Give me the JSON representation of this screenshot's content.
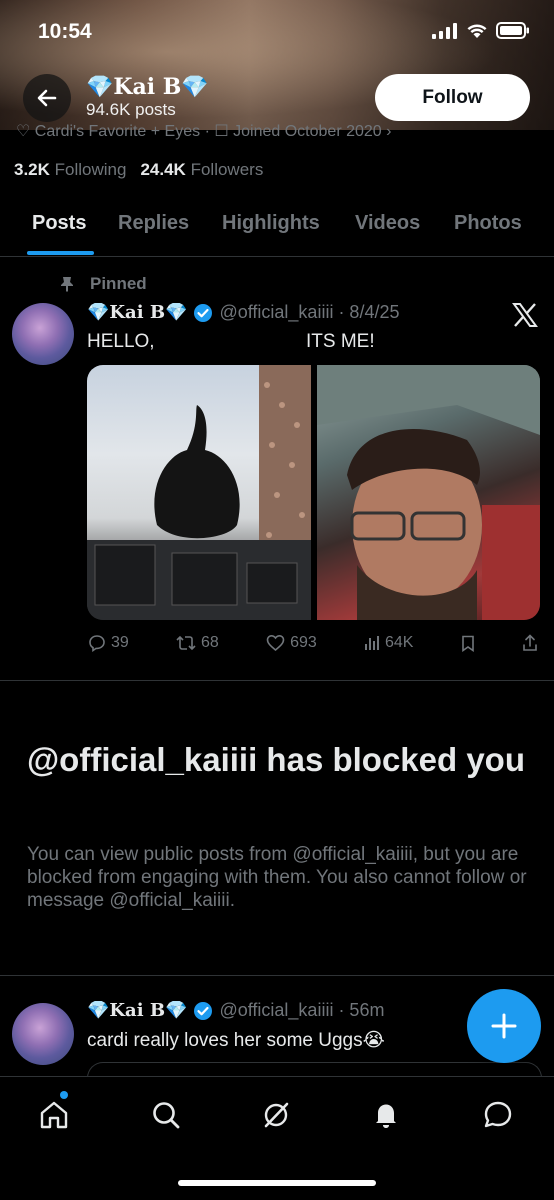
{
  "status_bar": {
    "time": "10:54"
  },
  "header": {
    "name": "💎Kai B💎",
    "posts_count": "94.6K posts",
    "follow_label": "Follow",
    "cutoff_text": "♡ Cardi's Favorite + Eyes · ☐ Joined October 2020 ›"
  },
  "profile": {
    "following_count": "3.2K",
    "following_label": "Following",
    "followers_count": "24.4K",
    "followers_label": "Followers"
  },
  "tabs": [
    {
      "label": "Posts",
      "active": true
    },
    {
      "label": "Replies"
    },
    {
      "label": "Highlights"
    },
    {
      "label": "Videos"
    },
    {
      "label": "Photos"
    }
  ],
  "pinned_post": {
    "pinned_label": "Pinned",
    "author_name": "💎Kai B💎",
    "handle_date": "@official_kaiiii · 8/4/25",
    "text_left": "HELLO,",
    "text_right": "ITS ME!",
    "stats": {
      "replies": "39",
      "reposts": "68",
      "likes": "693",
      "views": "64K"
    }
  },
  "blocked_notice": {
    "title": "@official_kaiiii has blocked you",
    "description": "You can view public posts from @official_kaiiii, but you are blocked from engaging with them. You also cannot follow or message @official_kaiiii."
  },
  "second_post": {
    "author_name": "💎Kai B💎",
    "handle_date": "@official_kaiiii · 56m",
    "text": "cardi really loves her some Uggs😭"
  },
  "colors": {
    "accent": "#1d9bf0",
    "verified": "#1d9bf0",
    "muted": "#71767b",
    "text": "#e7e9ea",
    "background": "#000000"
  },
  "icons": {
    "nav": [
      "home-icon",
      "search-icon",
      "grok-icon",
      "notifications-icon",
      "messages-icon"
    ]
  }
}
